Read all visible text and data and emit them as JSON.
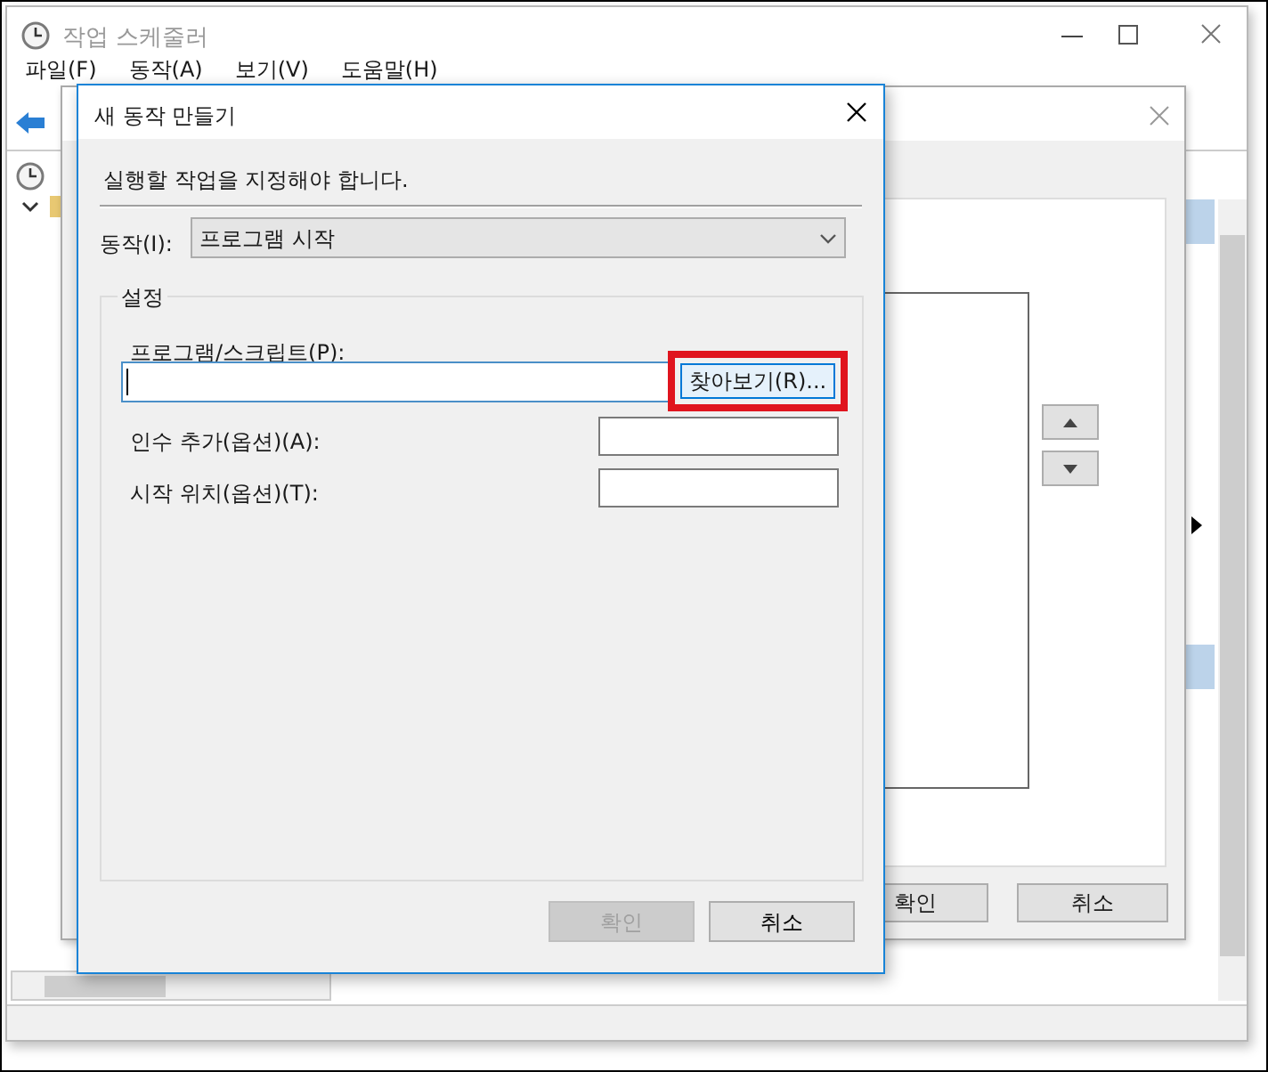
{
  "main_window": {
    "title": "작업 스케줄러",
    "menu": [
      "파일(F)",
      "동작(A)",
      "보기(V)",
      "도움말(H)"
    ]
  },
  "background_dialog": {
    "buttons": [
      {
        "label": "확인"
      },
      {
        "label": "취소"
      }
    ]
  },
  "dialog": {
    "title": "새 동작 만들기",
    "instruction": "실행할 작업을 지정해야 합니다.",
    "action_label": "동작(I):",
    "action_value": "프로그램 시작",
    "group_title": "설정",
    "program_label": "프로그램/스크립트(P):",
    "browse_button": {
      "label": "찾아보기(R)...",
      "highlighted": true
    },
    "fields": [
      {
        "label": "인수 추가(옵션)(A):"
      },
      {
        "label": "시작 위치(옵션)(T):"
      }
    ],
    "buttons": [
      {
        "label": "확인",
        "disabled": true
      },
      {
        "label": "취소",
        "disabled": false
      }
    ]
  }
}
